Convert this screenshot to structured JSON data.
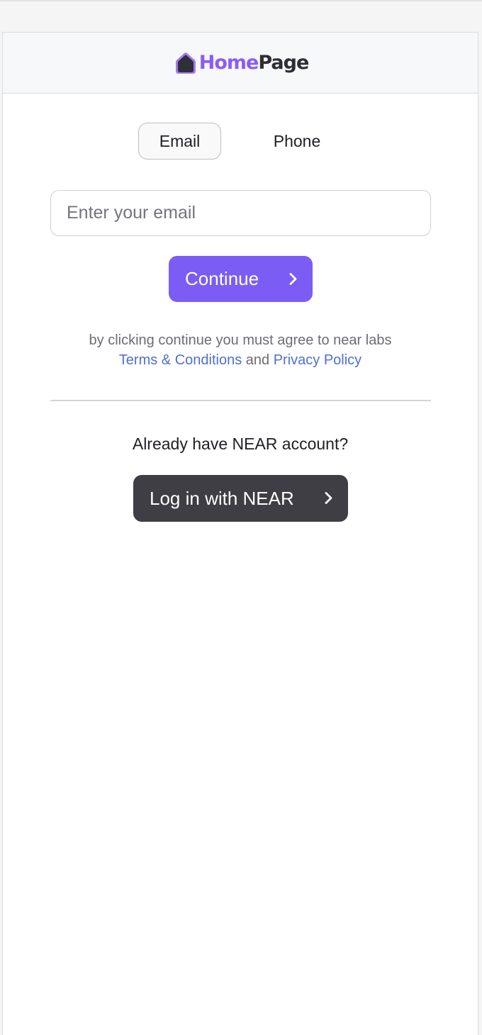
{
  "header": {
    "logo": {
      "icon": "house-icon",
      "brand_part1": "Home",
      "brand_part2": "Page",
      "brand_color": "#8b5cf6"
    }
  },
  "tabs": [
    {
      "label": "Email",
      "selected": true
    },
    {
      "label": "Phone",
      "selected": false
    }
  ],
  "email_input": {
    "value": "",
    "placeholder": "Enter your email"
  },
  "continue_button": {
    "label": "Continue",
    "icon": "chevron-right-icon",
    "color": "#7b5cf5"
  },
  "terms": {
    "prefix": "by clicking continue you must agree to near labs",
    "terms_link": "Terms & Conditions",
    "conjunction": "and",
    "privacy_link": "Privacy Policy",
    "link_color": "#4f6fd6"
  },
  "near_section": {
    "prompt": "Already have NEAR account?",
    "login_button": {
      "label": "Log in with NEAR",
      "icon": "chevron-right-icon",
      "color": "#3e3e44"
    }
  }
}
